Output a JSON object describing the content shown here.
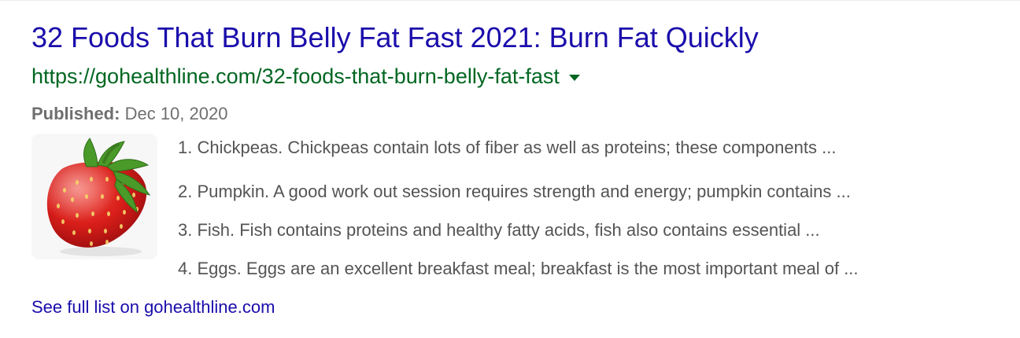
{
  "result": {
    "title": "32 Foods That Burn Belly Fat Fast 2021: Burn Fat Quickly",
    "url": "https://gohealthline.com/32-foods-that-burn-belly-fat-fast",
    "published_label": "Published:",
    "published_date": "Dec 10, 2020",
    "thumbnail_icon": "strawberry-image",
    "list_items": [
      "1. Chickpeas. Chickpeas contain lots of fiber as well as proteins; these components ...",
      "2. Pumpkin. A good work out session requires strength and energy; pumpkin contains ...",
      "3. Fish. Fish contains proteins and healthy fatty acids, fish also contains essential ...",
      "4. Eggs. Eggs are an excellent breakfast meal; breakfast is the most important meal of ..."
    ],
    "see_full_list": "See full list on gohealthline.com"
  },
  "colors": {
    "title_link": "#1a0dab",
    "url_green": "#006621",
    "snippet_gray": "#545454",
    "meta_gray": "#6f6f6f"
  }
}
